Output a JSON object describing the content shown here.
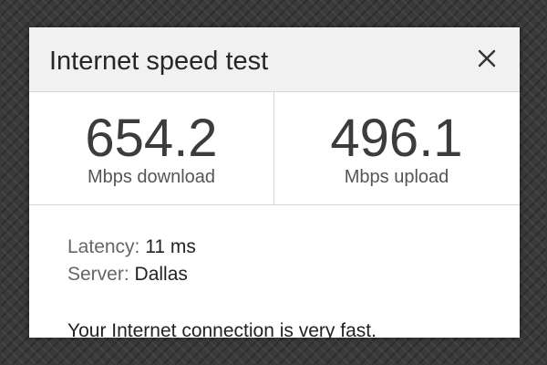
{
  "dialog": {
    "title": "Internet speed test",
    "close_icon": "close-icon"
  },
  "download": {
    "value": "654.2",
    "label": "Mbps download"
  },
  "upload": {
    "value": "496.1",
    "label": "Mbps upload"
  },
  "details": {
    "latency_label": "Latency:",
    "latency_value": "11 ms",
    "server_label": "Server:",
    "server_value": "Dallas"
  },
  "summary": "Your Internet connection is very fast."
}
